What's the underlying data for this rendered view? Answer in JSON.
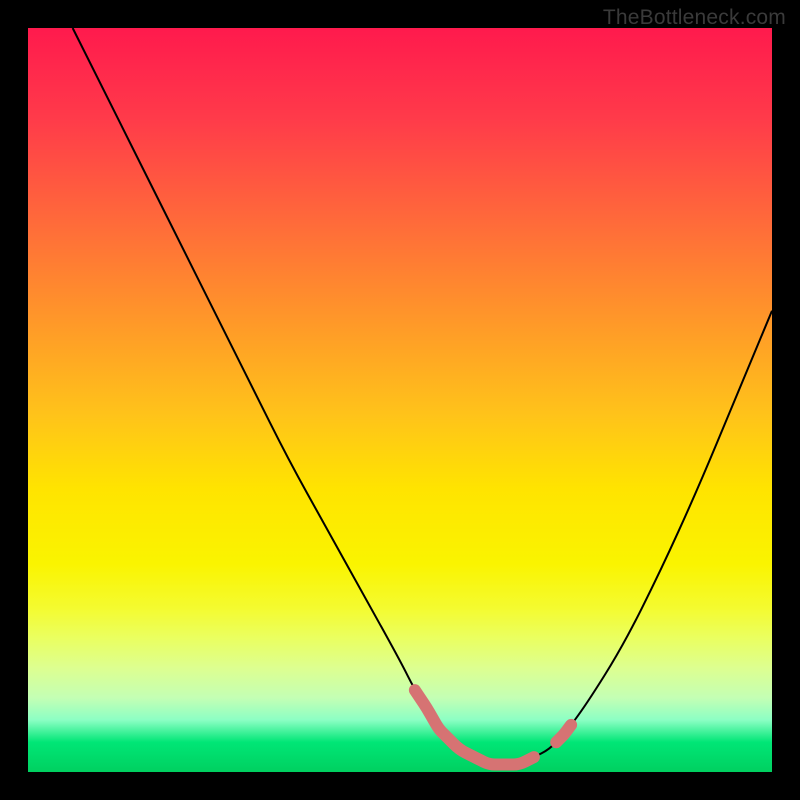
{
  "watermark": "TheBottleneck.com",
  "chart_data": {
    "type": "line",
    "title": "",
    "xlabel": "",
    "ylabel": "",
    "xlim": [
      0,
      100
    ],
    "ylim": [
      0,
      100
    ],
    "grid": false,
    "legend": false,
    "x": [
      6,
      10,
      15,
      20,
      25,
      30,
      35,
      40,
      45,
      50,
      52,
      54,
      55,
      58,
      60,
      62,
      64,
      66,
      68,
      70,
      72,
      75,
      80,
      85,
      90,
      95,
      100
    ],
    "y": [
      100,
      92,
      82,
      72,
      62,
      52,
      42,
      33,
      24,
      15,
      11,
      8,
      6,
      3,
      2,
      1,
      1,
      1,
      2,
      3,
      5,
      9,
      17,
      27,
      38,
      50,
      62
    ],
    "highlight_x_range": [
      52,
      68
    ],
    "highlight_right_tick_x": [
      71,
      73
    ]
  }
}
